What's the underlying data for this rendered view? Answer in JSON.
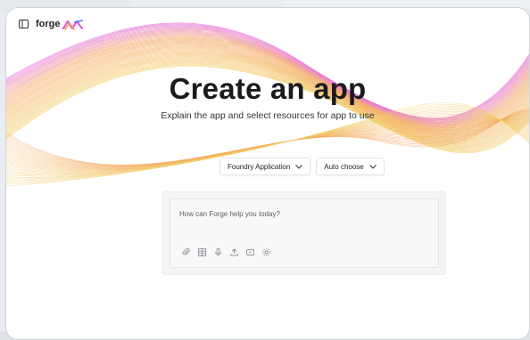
{
  "app": {
    "logo_text": "forge"
  },
  "hero": {
    "title": "Create an app",
    "subtitle": "Explain the app and select resources for app to use"
  },
  "selectors": {
    "application": "Foundry Application",
    "model": "Auto choose"
  },
  "composer": {
    "placeholder": "How can Forge help you today?",
    "tools": [
      "paperclip-icon",
      "table-icon",
      "microphone-icon",
      "upload-icon",
      "media-icon",
      "settings-icon"
    ]
  },
  "colors": {
    "wave_pink": "#e35bd8",
    "wave_orange": "#f3a25a",
    "wave_yellow": "#f2d06a",
    "title": "#1b1b1f"
  }
}
